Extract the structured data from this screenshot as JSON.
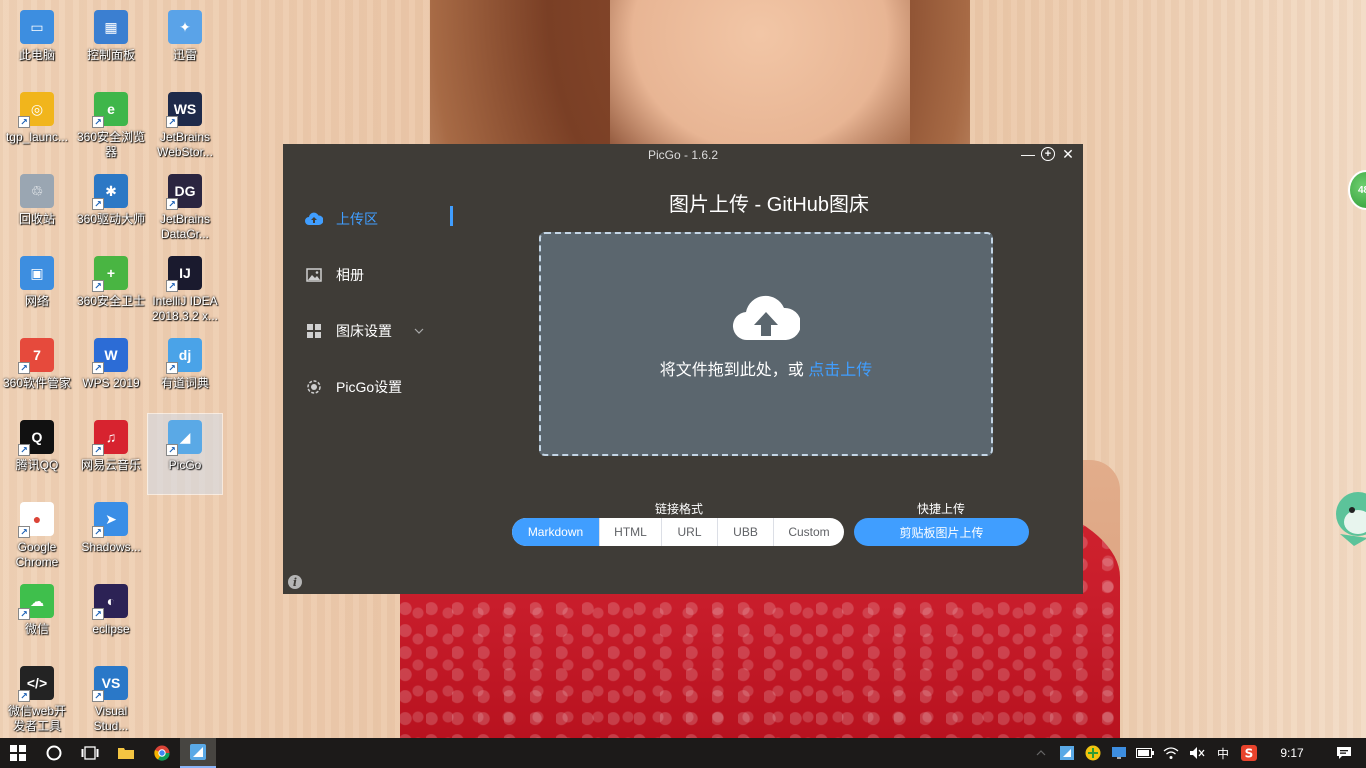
{
  "desktop": {
    "icons": [
      {
        "label": "此电脑",
        "color": "#3d8ee0",
        "glyph": "▭"
      },
      {
        "label": "控制面板",
        "color": "#3b7fd1",
        "glyph": "▦"
      },
      {
        "label": "迅雷",
        "color": "#5aa3e8",
        "glyph": "✦"
      },
      {
        "label": "tgp_launc...",
        "color": "#f1b51c",
        "glyph": "◎"
      },
      {
        "label": "360安全浏览\n器",
        "color": "#3fb64a",
        "glyph": "e"
      },
      {
        "label": "JetBrains\nWebStor...",
        "color": "#1e2a4a",
        "glyph": "WS"
      },
      {
        "label": "回收站",
        "color": "#9aa6b2",
        "glyph": "♲"
      },
      {
        "label": "360驱动大师",
        "color": "#2c78c5",
        "glyph": "✱"
      },
      {
        "label": "JetBrains\nDataGr...",
        "color": "#2b2540",
        "glyph": "DG"
      },
      {
        "label": "网络",
        "color": "#3d8ee0",
        "glyph": "▣"
      },
      {
        "label": "360安全卫士",
        "color": "#49b542",
        "glyph": "+"
      },
      {
        "label": "IntelliJ IDEA\n2018.3.2 x...",
        "color": "#1a1a2e",
        "glyph": "IJ"
      },
      {
        "label": "360软件管家",
        "color": "#e64a3c",
        "glyph": "7"
      },
      {
        "label": "WPS 2019",
        "color": "#2c6cd6",
        "glyph": "W"
      },
      {
        "label": "有道词典",
        "color": "#4aa3e8",
        "glyph": "dj"
      },
      {
        "label": "腾讯QQ",
        "color": "#111111",
        "glyph": "Q"
      },
      {
        "label": "网易云音乐",
        "color": "#d7232f",
        "glyph": "♫"
      },
      {
        "label": "PicGo",
        "color": "#5aa9e6",
        "glyph": "◢"
      },
      {
        "label": "Google\nChrome",
        "color": "#ffffff",
        "glyph": "●"
      },
      {
        "label": "Shadows...",
        "color": "#3a8ee6",
        "glyph": "➤"
      },
      {
        "label": "微信",
        "color": "#3fbf4c",
        "glyph": "☁"
      },
      {
        "label": "eclipse",
        "color": "#2c2255",
        "glyph": "◐"
      },
      {
        "label": "微信web开\n发者工具",
        "color": "#232323",
        "glyph": "</>"
      },
      {
        "label": "Visual\nStud...",
        "color": "#2a78c8",
        "glyph": "VS"
      }
    ]
  },
  "window": {
    "title": "PicGo - 1.6.2",
    "controls": {
      "minimize": "—",
      "maximize": "+",
      "close": "✕"
    },
    "nav": [
      {
        "label": "上传区",
        "icon": "upload-cloud-icon",
        "active": true
      },
      {
        "label": "相册",
        "icon": "image-icon",
        "active": false
      },
      {
        "label": "图床设置",
        "icon": "grid-icon",
        "active": false
      },
      {
        "label": "PicGo设置",
        "icon": "gear-icon",
        "active": false
      }
    ],
    "info_glyph": "i",
    "main_title": "图片上传 - GitHub图床",
    "dropzone": {
      "text": "将文件拖到此处，或 ",
      "link": "点击上传"
    },
    "link_format": {
      "label": "链接格式",
      "options": [
        "Markdown",
        "HTML",
        "URL",
        "UBB",
        "Custom"
      ],
      "selected": "Markdown"
    },
    "quick_upload": {
      "label": "快捷上传",
      "button": "剪贴板图片上传"
    }
  },
  "taskbar": {
    "tray": {
      "ime": "中",
      "time": "9:17"
    }
  },
  "widgets": {
    "ball_text": "48"
  },
  "colors": {
    "accent": "#409eff",
    "window_bg": "#3f3c37",
    "dropzone_bg": "#5b666e",
    "taskbar_bg": "#1c1a19"
  }
}
